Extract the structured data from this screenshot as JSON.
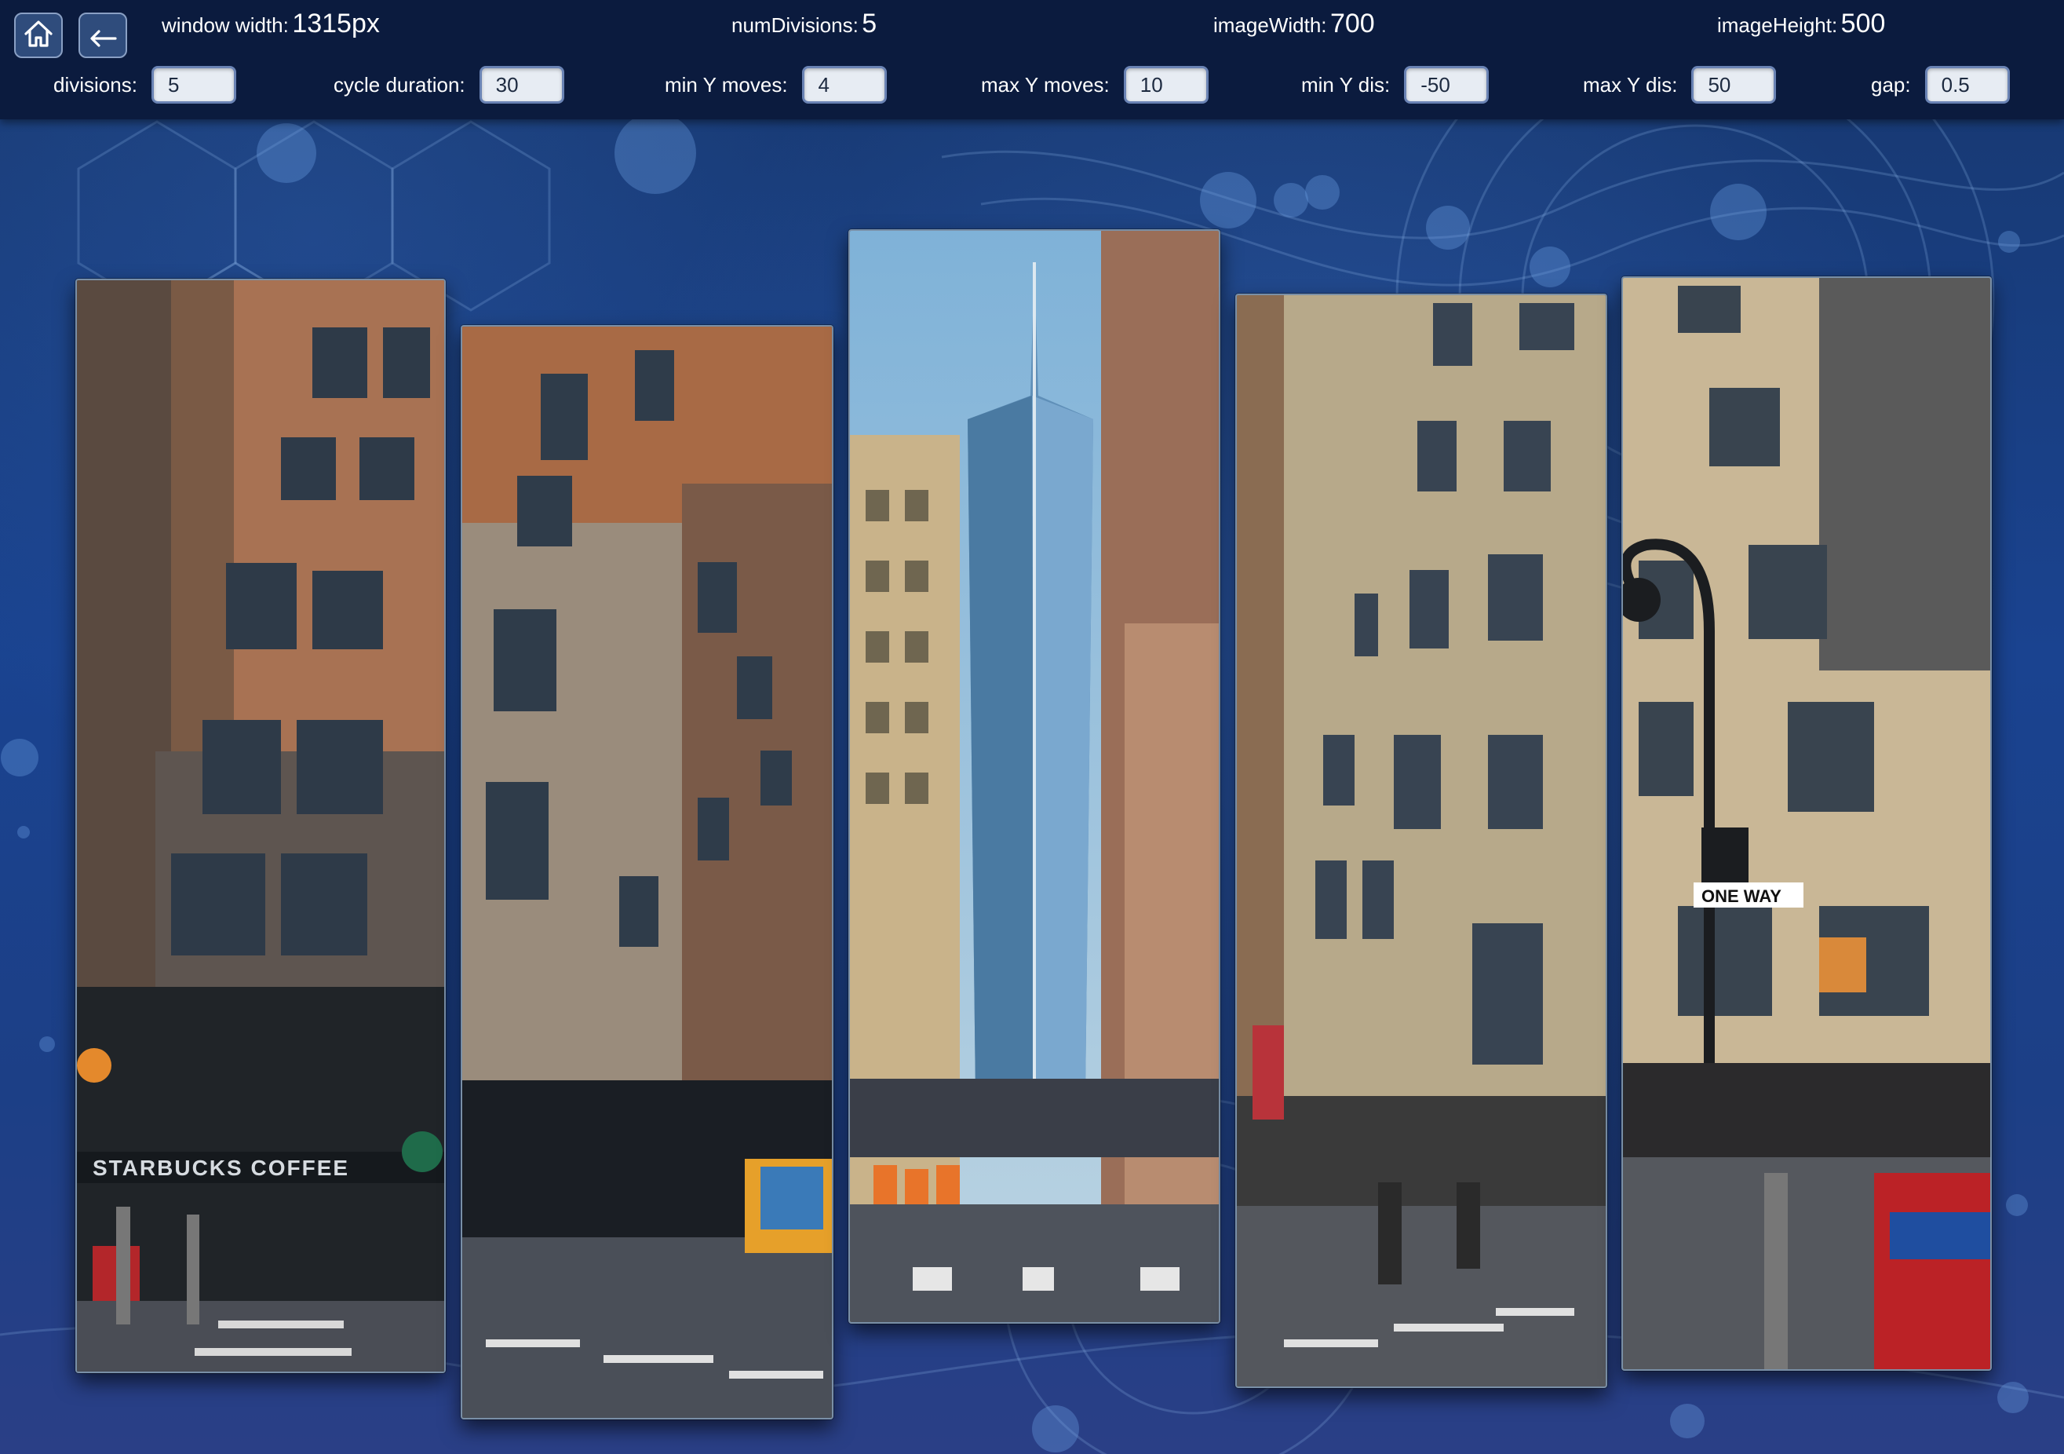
{
  "toolbar": {
    "home_icon": "home-icon",
    "back_icon": "undo-arrow-icon",
    "stats": {
      "window_width_label": "window width:",
      "window_width_value": "1315px",
      "num_divisions_label": "numDivisions:",
      "num_divisions_value": "5",
      "image_width_label": "imageWidth:",
      "image_width_value": "700",
      "image_height_label": "imageHeight:",
      "image_height_value": "500"
    },
    "controls": {
      "divisions_label": "divisions:",
      "divisions_value": "5",
      "cycle_duration_label": "cycle duration:",
      "cycle_duration_value": "30",
      "min_y_moves_label": "min Y moves:",
      "min_y_moves_value": "4",
      "max_y_moves_label": "max Y moves:",
      "max_y_moves_value": "10",
      "min_y_dis_label": "min Y dis:",
      "min_y_dis_value": "-50",
      "max_y_dis_label": "max Y dis:",
      "max_y_dis_value": "50",
      "gap_label": "gap:",
      "gap_value": "0.5"
    }
  },
  "photo": {
    "sign_starbucks": "STARBUCKS COFFEE",
    "sign_one_way": "ONE WAY"
  }
}
